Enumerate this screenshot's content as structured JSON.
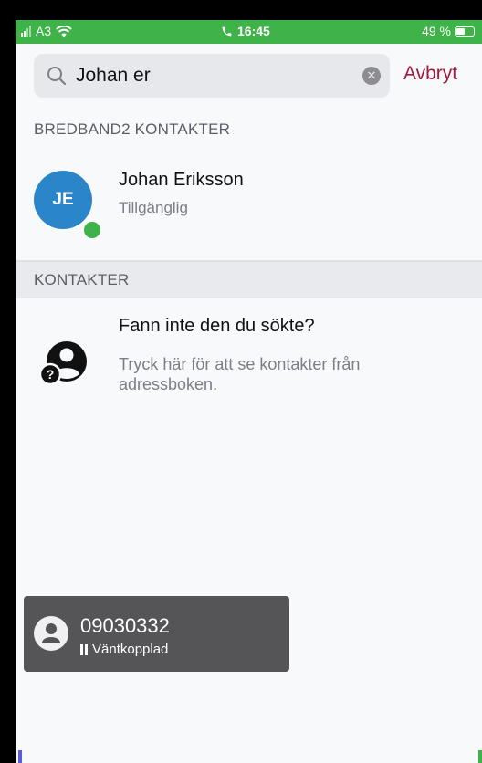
{
  "status_bar": {
    "carrier": "A3",
    "time": "16:45",
    "battery": "49 %",
    "battery_level": 0.49,
    "background_color": "#3fb24a"
  },
  "search": {
    "query": "Johan er",
    "cancel_label": "Avbryt",
    "search_icon": "search-icon",
    "clear_icon": "clear-icon"
  },
  "sections": {
    "bredband": "BREDBAND2 KONTAKTER",
    "kontakter": "KONTAKTER"
  },
  "contact": {
    "initials": "JE",
    "name": "Johan Eriksson",
    "status": "Tillgänglig",
    "avatar_color": "#2b85c9",
    "presence_color": "#3fb24a"
  },
  "addressbook": {
    "title": "Fann inte den du sökte?",
    "description": "Tryck här för att se kontakter från adressboken.",
    "icon": "contact-unknown-icon"
  },
  "call": {
    "number": "09030332",
    "state": "Väntkopplad",
    "state_icon": "pause-icon"
  },
  "colors": {
    "accent": "#9e1a3a",
    "banner": "#555558"
  }
}
